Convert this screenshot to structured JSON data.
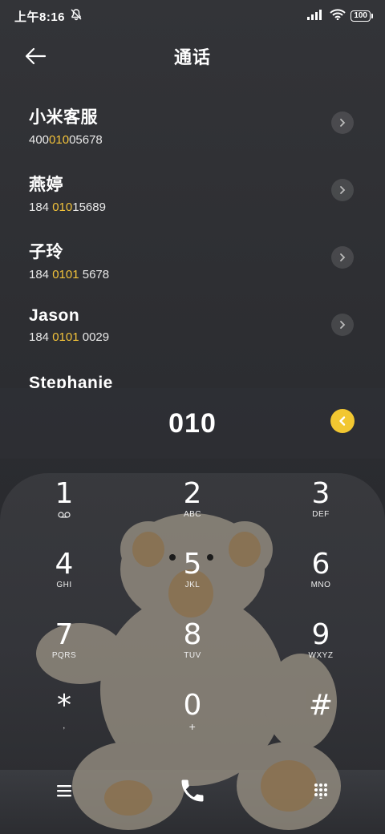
{
  "status_bar": {
    "time": "上午8:16",
    "battery": "100",
    "icons": [
      "mute-icon",
      "signal-icon",
      "wifi-icon",
      "battery-icon"
    ]
  },
  "header": {
    "title": "通话",
    "back_icon": "arrow-left-icon"
  },
  "contacts": [
    {
      "name": "小米客服",
      "number_pre": "400",
      "number_hl": "010",
      "number_post": "05678"
    },
    {
      "name": "燕婷",
      "number_pre": "184 ",
      "number_hl": "010",
      "number_post": "15689"
    },
    {
      "name": "子玲",
      "number_pre": "184 ",
      "number_hl": "0101",
      "number_post": " 5678"
    },
    {
      "name": "Jason",
      "number_pre": "184 ",
      "number_hl": "0101",
      "number_post": " 0029"
    },
    {
      "name": "Stephanie",
      "number_pre": "",
      "number_hl": "",
      "number_post": ""
    }
  ],
  "dial": {
    "digits": "010",
    "delete_icon": "backspace-icon",
    "accent_color": "#f2c731"
  },
  "keypad": {
    "keys": [
      {
        "digit": "1",
        "letters": ""
      },
      {
        "digit": "2",
        "letters": "ABC"
      },
      {
        "digit": "3",
        "letters": "DEF"
      },
      {
        "digit": "4",
        "letters": "GHI"
      },
      {
        "digit": "5",
        "letters": "JKL"
      },
      {
        "digit": "6",
        "letters": "MNO"
      },
      {
        "digit": "7",
        "letters": "PQRS"
      },
      {
        "digit": "8",
        "letters": "TUV"
      },
      {
        "digit": "9",
        "letters": "WXYZ"
      },
      {
        "digit": "*",
        "letters": ","
      },
      {
        "digit": "0",
        "letters": "+"
      },
      {
        "digit": "#",
        "letters": ""
      }
    ]
  },
  "bottom_bar": {
    "icons": [
      "menu-icon",
      "call-icon",
      "keypad-icon"
    ]
  },
  "colors": {
    "highlight": "#f3c33a"
  }
}
